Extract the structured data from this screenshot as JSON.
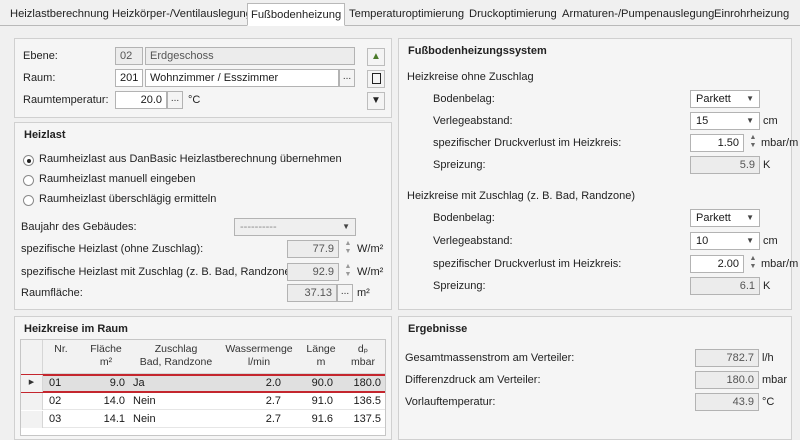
{
  "tabs": [
    "Heizlastberechnung",
    "Heizkörper-/Ventilauslegung",
    "Fußbodenheizung",
    "Temperaturoptimierung",
    "Druckoptimierung",
    "Armaturen-/Pumpenauslegung",
    "Einrohrheizung"
  ],
  "room": {
    "ebene_label": "Ebene:",
    "ebene_nr": "02",
    "ebene_name": "Erdgeschoss",
    "raum_label": "Raum:",
    "raum_nr": "201",
    "raum_name": "Wohnzimmer / Esszimmer",
    "temp_label": "Raumtemperatur:",
    "temp_value": "20.0",
    "temp_unit": "°C",
    "dots": "..."
  },
  "heizlast": {
    "title": "Heizlast",
    "radio1": "Raumheizlast aus DanBasic Heizlastberechnung übernehmen",
    "radio2": "Raumheizlast manuell eingeben",
    "radio3": "Raumheizlast überschlägig ermitteln",
    "baujahr_label": "Baujahr des Gebäudes:",
    "baujahr_value": "----------",
    "spez1_label": "spezifische Heizlast (ohne Zuschlag):",
    "spez1_value": "77.9",
    "spez1_unit": "W/m²",
    "spez2_label": "spezifische Heizlast mit Zuschlag (z. B. Bad, Randzone):",
    "spez2_value": "92.9",
    "spez2_unit": "W/m²",
    "flaeche_label": "Raumfläche:",
    "flaeche_value": "37.13",
    "flaeche_unit": "m²"
  },
  "fbh": {
    "title": "Fußbodenheizungssystem",
    "ohne_title": "Heizkreise ohne Zuschlag",
    "belag_label": "Bodenbelag:",
    "belag1": "Parkett",
    "abstand_label": "Verlegeabstand:",
    "abstand1": "15",
    "cm": "cm",
    "druck_label": "spezifischer Druckverlust im Heizkreis:",
    "druck1": "1.50",
    "druck_unit": "mbar/m",
    "spreiz_label": "Spreizung:",
    "spreiz1": "5.9",
    "k": "K",
    "mit_title": "Heizkreise mit Zuschlag (z. B. Bad, Randzone)",
    "belag2": "Parkett",
    "abstand2": "10",
    "druck2": "2.00",
    "spreiz2": "6.1"
  },
  "heizkreise": {
    "title": "Heizkreise im Raum",
    "columns": [
      {
        "l1": "Nr.",
        "l2": ""
      },
      {
        "l1": "Fläche",
        "l2": "m²"
      },
      {
        "l1": "Zuschlag",
        "l2": "Bad, Randzone"
      },
      {
        "l1": "Wassermenge",
        "l2": "l/min"
      },
      {
        "l1": "Länge",
        "l2": "m"
      },
      {
        "l1": "dₚ",
        "l2": "mbar"
      }
    ],
    "rows": [
      {
        "nr": "01",
        "flaeche": "9.0",
        "zuschlag": "Ja",
        "wasser": "2.0",
        "laenge": "90.0",
        "dp": "180.0"
      },
      {
        "nr": "02",
        "flaeche": "14.0",
        "zuschlag": "Nein",
        "wasser": "2.7",
        "laenge": "91.0",
        "dp": "136.5"
      },
      {
        "nr": "03",
        "flaeche": "14.1",
        "zuschlag": "Nein",
        "wasser": "2.7",
        "laenge": "91.6",
        "dp": "137.5"
      }
    ]
  },
  "ergebnisse": {
    "title": "Ergebnisse",
    "masse_label": "Gesamtmassenstrom am Verteiler:",
    "masse_value": "782.7",
    "masse_unit": "l/h",
    "diff_label": "Differenzdruck am Verteiler:",
    "diff_value": "180.0",
    "diff_unit": "mbar",
    "vorlauf_label": "Vorlauftemperatur:",
    "vorlauf_value": "43.9",
    "vorlauf_unit": "°C"
  }
}
